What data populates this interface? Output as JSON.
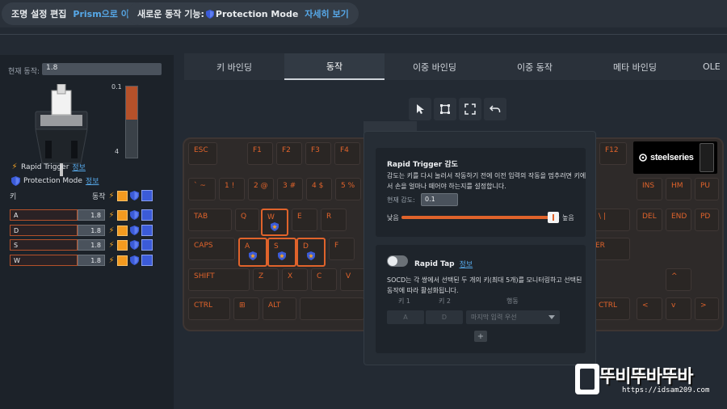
{
  "topbar": {
    "edit_lighting": "조명 설정 편집",
    "go_prism": "Prism으로 이동",
    "new_feature": "새로운 동작 기능:",
    "protection_mode": "Protection Mode",
    "see_more": "자세히 보기"
  },
  "left": {
    "current_label": "현재 동작:",
    "current_value": "1.8",
    "scale_top": "0.1",
    "scale_bottom": "4",
    "bar_level_fraction": 0.47,
    "rapid_trigger": "Rapid Trigger",
    "protection_mode": "Protection Mode",
    "info": "정보",
    "col_key": "키",
    "col_action": "동작",
    "rows": [
      {
        "key": "A",
        "value": "1.8"
      },
      {
        "key": "D",
        "value": "1.8"
      },
      {
        "key": "S",
        "value": "1.8"
      },
      {
        "key": "W",
        "value": "1.8"
      }
    ]
  },
  "tabs": [
    "키 바인딩",
    "동작",
    "이중 바인딩",
    "이중 동작",
    "메타 바인딩",
    "OLE"
  ],
  "active_tab": 1,
  "toolbar_icons": [
    "cursor-icon",
    "select-box-icon",
    "fullscreen-icon",
    "undo-icon"
  ],
  "keyboard": {
    "keys": {
      "esc": "ESC",
      "f1": "F1",
      "f2": "F2",
      "f3": "F3",
      "f4": "F4",
      "f12": "F12",
      "grave": "` ~",
      "k1": "1 !",
      "k2": "2 @",
      "k3": "3 #",
      "k4": "4 $",
      "k5": "5 %",
      "ins": "INS",
      "hm": "HM",
      "pu": "PU",
      "tab": "TAB",
      "q": "Q",
      "w": "W",
      "e": "E",
      "r": "R",
      "bslash": "\\ |",
      "del": "DEL",
      "end": "END",
      "pd": "PD",
      "caps": "CAPS",
      "a": "A",
      "s": "S",
      "d": "D",
      "f": "F",
      "enter": "ER",
      "shift": "SHIFT",
      "z": "Z",
      "x": "X",
      "c": "C",
      "v": "V",
      "up": "^",
      "ctrl": "CTRL",
      "win": "⊞",
      "alt": "ALT",
      "rctrl": "CTRL",
      "left": "<",
      "down": "v",
      "right": ">"
    },
    "logo_text": "steelseries"
  },
  "modal": {
    "rapid_trigger_title": "Rapid Trigger 감도",
    "rapid_trigger_desc": "감도는 키를 다시 눌러서 작동하기 전에 이전 입력의 작동을 멈추려면 키에서 손을 얼마나 떼어야 하는지를 설정합니다.",
    "current_sensitivity_label": "현재 감도:",
    "current_sensitivity_value": "0.1",
    "slider_low": "낮음",
    "slider_high": "높음",
    "slider_fraction": 0.96,
    "rapid_tap_title": "Rapid Tap",
    "rapid_tap_info": "정보",
    "rapid_tap_desc": "SOCD는 각 쌍에서 선택된 두 개의 키(최대 5개)를 모니터링하고 선택된 동작에 따라 활성화됩니다.",
    "col_key1": "키 1",
    "col_key2": "키 2",
    "col_action": "행동",
    "key1_value": "A",
    "key2_value": "D",
    "action_value": "마지막 입력 우선",
    "add": "+"
  },
  "watermark": {
    "text": "뚜비뚜바뚜바",
    "url": "https://idsam209.com"
  },
  "colors": {
    "accent": "#e0632b",
    "link": "#56a8e8",
    "shield": "#3b5bd8"
  }
}
